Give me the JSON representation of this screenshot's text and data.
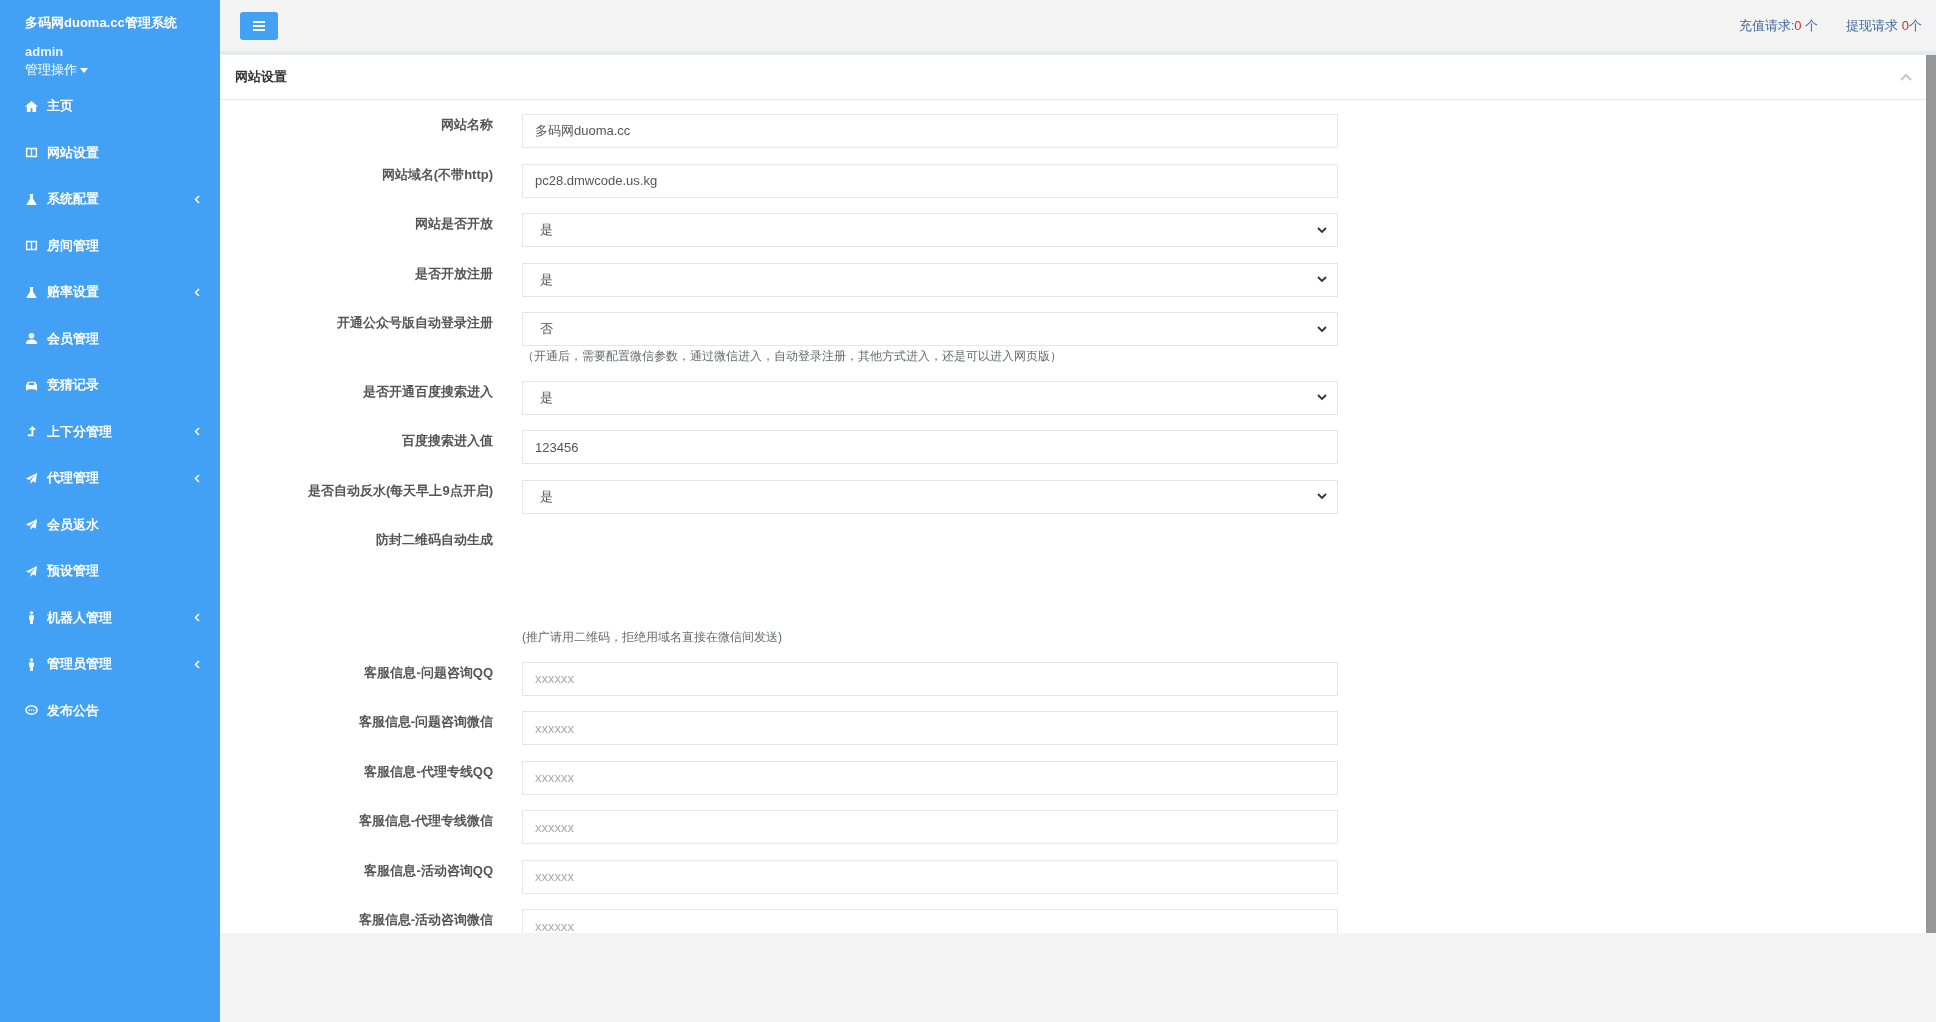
{
  "sidebar": {
    "brand": "多码网duoma.cc管理系统",
    "user": "admin",
    "user_menu": "管理操作",
    "items": [
      {
        "label": "主页",
        "expandable": false
      },
      {
        "label": "网站设置",
        "expandable": false
      },
      {
        "label": "系统配置",
        "expandable": true
      },
      {
        "label": "房间管理",
        "expandable": false
      },
      {
        "label": "赔率设置",
        "expandable": true
      },
      {
        "label": "会员管理",
        "expandable": false
      },
      {
        "label": "竞猜记录",
        "expandable": false
      },
      {
        "label": "上下分管理",
        "expandable": true
      },
      {
        "label": "代理管理",
        "expandable": true
      },
      {
        "label": "会员返水",
        "expandable": false
      },
      {
        "label": "预设管理",
        "expandable": false
      },
      {
        "label": "机器人管理",
        "expandable": true
      },
      {
        "label": "管理员管理",
        "expandable": true
      },
      {
        "label": "发布公告",
        "expandable": false
      }
    ]
  },
  "topbar": {
    "requests": [
      {
        "label": "充值请求:",
        "count": "0",
        "unit": " 个"
      },
      {
        "label": "提现请求 ",
        "count": "0",
        "unit": "个"
      }
    ]
  },
  "panel": {
    "title": "网站设置",
    "fields": [
      {
        "kind": "text",
        "label": "网站名称",
        "value": "多码网duoma.cc"
      },
      {
        "kind": "text",
        "label": "网站域名(不带http)",
        "value": "pc28.dmwcode.us.kg"
      },
      {
        "kind": "select",
        "label": "网站是否开放",
        "value": "是"
      },
      {
        "kind": "select",
        "label": "是否开放注册",
        "value": "是"
      },
      {
        "kind": "select",
        "label": "开通公众号版自动登录注册",
        "value": "否",
        "help": "（开通后，需要配置微信参数，通过微信进入，自动登录注册，其他方式进入，还是可以进入网页版）"
      },
      {
        "kind": "select",
        "label": "是否开通百度搜索进入",
        "value": "是"
      },
      {
        "kind": "text",
        "label": "百度搜索进入值",
        "value": "123456"
      },
      {
        "kind": "select",
        "label": "是否自动反水(每天早上9点开启)",
        "value": "是"
      },
      {
        "kind": "blank",
        "label": "防封二维码自动生成",
        "help": "(推广请用二维码，拒绝用域名直接在微信间发送)"
      },
      {
        "kind": "text",
        "label": "客服信息-问题咨询QQ",
        "placeholder": "xxxxxx"
      },
      {
        "kind": "text",
        "label": "客服信息-问题咨询微信",
        "placeholder": "xxxxxx"
      },
      {
        "kind": "text",
        "label": "客服信息-代理专线QQ",
        "placeholder": "xxxxxx"
      },
      {
        "kind": "text",
        "label": "客服信息-代理专线微信",
        "placeholder": "xxxxxx"
      },
      {
        "kind": "text",
        "label": "客服信息-活动咨询QQ",
        "placeholder": "xxxxxx"
      },
      {
        "kind": "text",
        "label": "客服信息-活动咨询微信",
        "placeholder": "xxxxxx"
      }
    ]
  }
}
